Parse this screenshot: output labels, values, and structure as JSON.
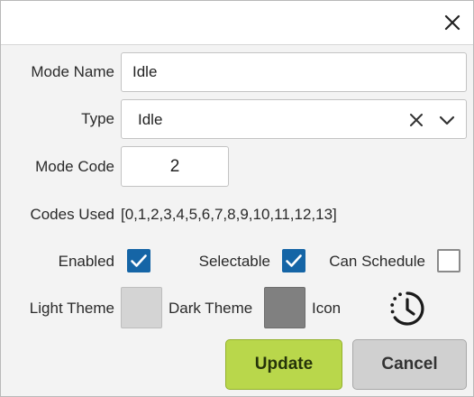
{
  "form": {
    "mode_name": {
      "label": "Mode Name",
      "value": "Idle"
    },
    "type": {
      "label": "Type",
      "value": "Idle"
    },
    "mode_code": {
      "label": "Mode Code",
      "value": "2"
    },
    "codes_used": {
      "label": "Codes Used",
      "value": "[0,1,2,3,4,5,6,7,8,9,10,11,12,13]"
    },
    "enabled": {
      "label": "Enabled",
      "checked": true
    },
    "selectable": {
      "label": "Selectable",
      "checked": true
    },
    "can_schedule": {
      "label": "Can Schedule",
      "checked": false
    },
    "light_theme": {
      "label": "Light Theme",
      "color": "#d4d4d4"
    },
    "dark_theme": {
      "label": "Dark Theme",
      "color": "#808080"
    },
    "icon": {
      "label": "Icon",
      "name": "clock-history-icon"
    }
  },
  "buttons": {
    "update": {
      "label": "Update",
      "color": "#b9d74b"
    },
    "cancel": {
      "label": "Cancel",
      "color": "#d0d0d0"
    }
  },
  "colors": {
    "checkbox_accent": "#1565a6"
  }
}
